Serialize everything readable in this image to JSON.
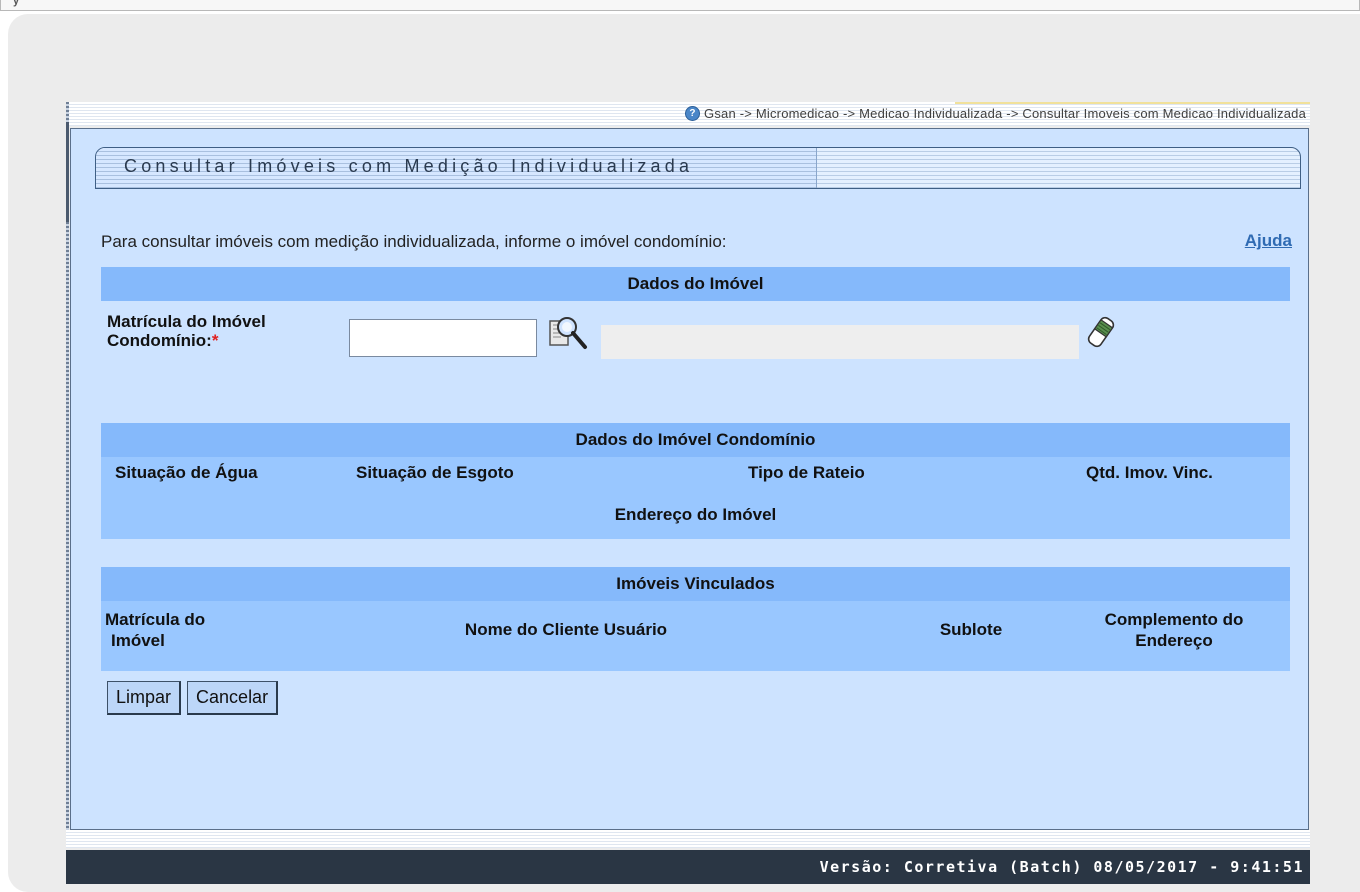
{
  "top_fragment": "y",
  "breadcrumb": {
    "text": "Gsan -> Micromedicao -> Medicao Individualizada -> Consultar Imoveis com Medicao Individualizada"
  },
  "page": {
    "title": "Consultar Imóveis com Medição Individualizada",
    "instructions": "Para consultar imóveis com medição individualizada, informe o imóvel condomínio:",
    "help_link": "Ajuda"
  },
  "dados_imovel": {
    "header": "Dados do Imóvel",
    "matricula_label_line1": "Matrícula do Imóvel",
    "matricula_label_line2": "Condomínio:",
    "required_mark": "*",
    "matricula_value": "",
    "description_value": ""
  },
  "dados_condominio": {
    "header": "Dados do Imóvel Condomínio",
    "col_agua": "Situação de Água",
    "col_esgoto": "Situação de Esgoto",
    "col_rateio": "Tipo de Rateio",
    "col_qtd": "Qtd. Imov. Vinc.",
    "endereco": "Endereço do Imóvel"
  },
  "imoveis_vinculados": {
    "header": "Imóveis Vinculados",
    "col_matricula_1": "Matrícula do",
    "col_matricula_2": "Imóvel",
    "col_cliente": "Nome do Cliente Usuário",
    "col_sublote": "Sublote",
    "col_complemento_1": "Complemento do",
    "col_complemento_2": "Endereço"
  },
  "buttons": {
    "limpar": "Limpar",
    "cancelar": "Cancelar"
  },
  "footer": {
    "version": "Versão: Corretiva (Batch) 08/05/2017 - 9:41:51"
  },
  "icons": {
    "help": "help-circle-icon",
    "search": "magnifier-search-icon",
    "clear": "eraser-icon"
  },
  "colors": {
    "content_bg": "#cde3ff",
    "section_header": "#85b9fb",
    "section_body": "#99c7ff",
    "link": "#2f6bb3",
    "footer_bg": "#2a3644"
  }
}
